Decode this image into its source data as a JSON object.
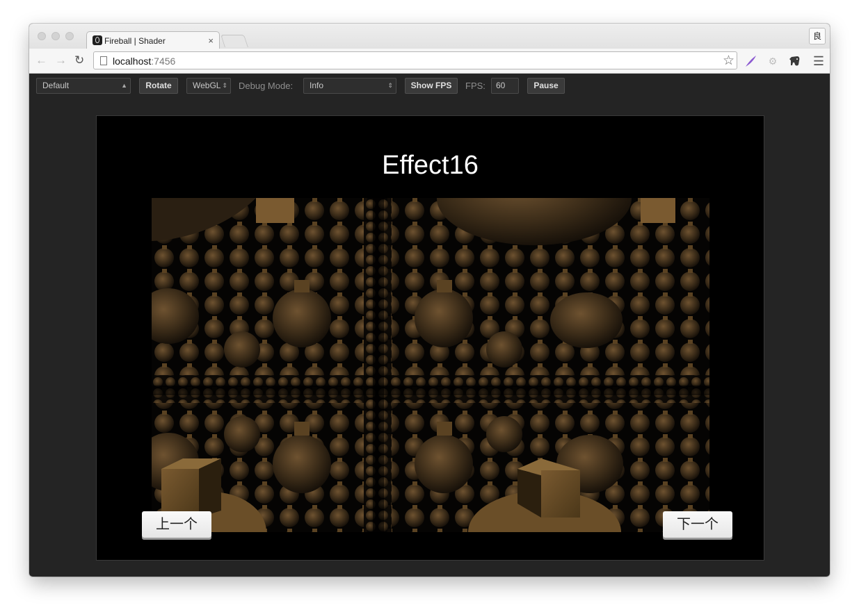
{
  "browser": {
    "tab_title": "Fireball | Shader",
    "tab_close": "×",
    "url_host": "localhost",
    "url_port": ":7456",
    "profile_label": "良"
  },
  "controls": {
    "preset_select": "Default",
    "rotate_button": "Rotate",
    "renderer_select": "WebGL",
    "debug_mode_label": "Debug Mode:",
    "debug_mode_select": "Info",
    "show_fps_button": "Show FPS",
    "fps_label": "FPS:",
    "fps_value": "60",
    "pause_button": "Pause"
  },
  "scene": {
    "title": "Effect16",
    "prev_button": "上一个",
    "next_button": "下一个"
  },
  "icons": {
    "back": "back-arrow-icon",
    "forward": "forward-arrow-icon",
    "reload": "reload-icon",
    "page": "page-icon",
    "star": "star-icon",
    "feather": "feather-icon",
    "extension": "gear-icon",
    "evernote": "elephant-icon",
    "menu": "hamburger-menu-icon"
  },
  "colors": {
    "app_background": "#242424",
    "stage_background": "#000000",
    "sphere_tone": "#7a5a30"
  }
}
